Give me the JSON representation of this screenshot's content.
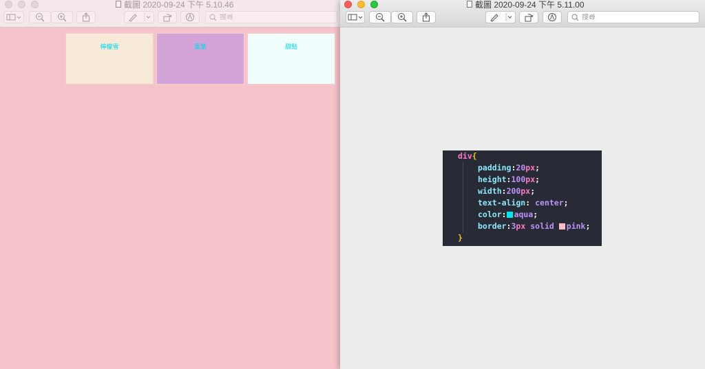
{
  "back_window": {
    "title": "截圖 2020-09-24 下午 5.10.46",
    "search_placeholder": "搜尋",
    "boxes": [
      {
        "label": "檸檬雪",
        "color": "#f7ead9"
      },
      {
        "label": "薰紫",
        "color": "#d4a4d8"
      },
      {
        "label": "甜點",
        "color": "#f0fffe"
      }
    ]
  },
  "front_window": {
    "title": "截圖 2020-09-24 下午 5.11.00",
    "search_placeholder": "搜尋"
  },
  "code": {
    "selector": "div",
    "open_brace": "{",
    "close_brace": "}",
    "lines": [
      {
        "prop": "padding",
        "num": "20",
        "unit": "px"
      },
      {
        "prop": "height",
        "num": "100",
        "unit": "px"
      },
      {
        "prop": "width",
        "num": "200",
        "unit": "px"
      },
      {
        "prop": "text-align",
        "value": "center"
      },
      {
        "prop": "color",
        "value": "aqua",
        "swatch": "#00e5ee"
      },
      {
        "prop": "border",
        "num": "3",
        "unit": "px",
        "value": "solid",
        "swatch": "#f7c0c7",
        "value2": "pink"
      }
    ]
  },
  "colors": {
    "desktop_pink": "#f4c3ca",
    "code_bg": "#282a36"
  }
}
